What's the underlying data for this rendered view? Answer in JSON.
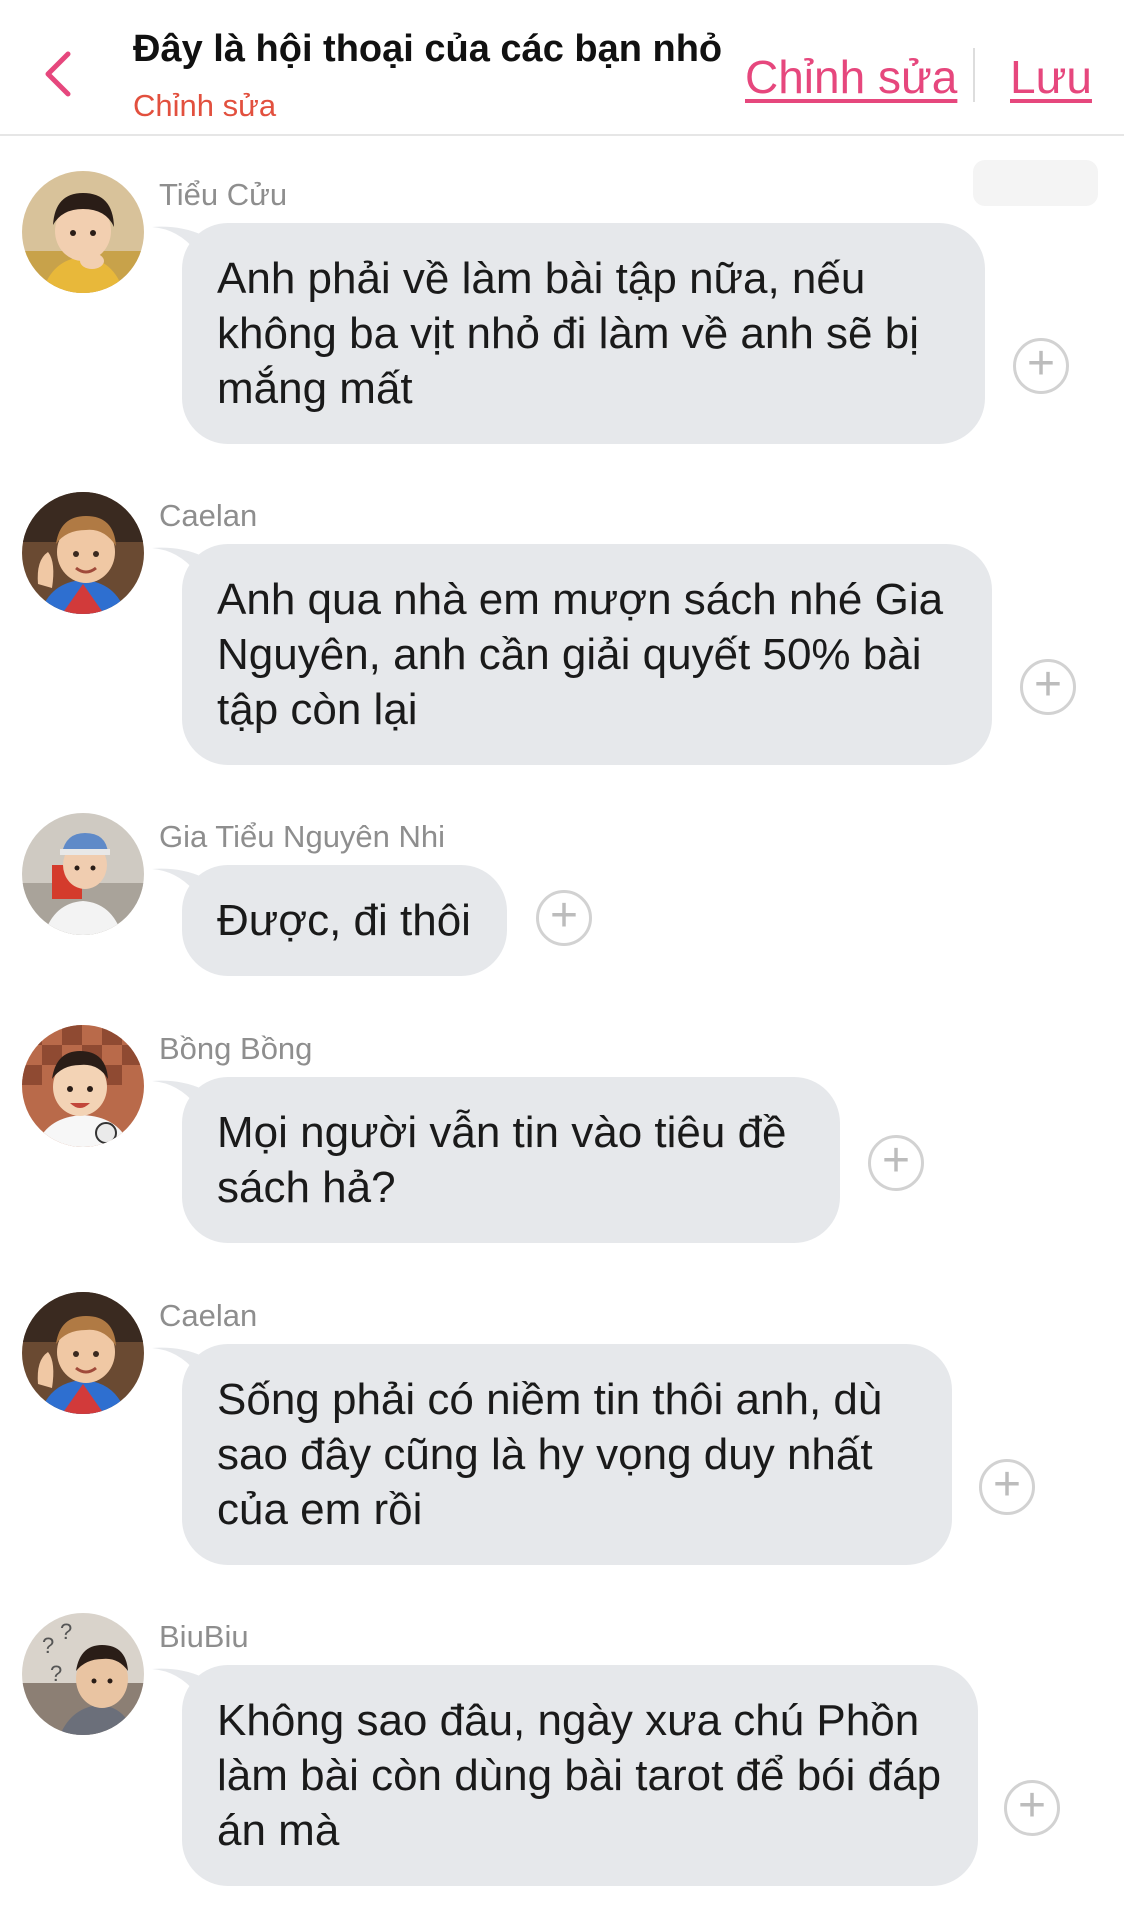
{
  "header": {
    "title": "Đây là hội thoại của các bạn nhỏ",
    "subtitle": "Chỉnh sửa",
    "edit_label": "Chỉnh sửa",
    "save_label": "Lưu",
    "accent_color": "#e6477d",
    "back_icon": "chevron-left-icon"
  },
  "messages": [
    {
      "sender": "Tiểu Cửu",
      "text": "Anh phải về làm bài tập nữa, nếu không ba vịt nhỏ đi làm về anh sẽ bị mắng mất",
      "add_icon": "plus-circle-icon"
    },
    {
      "sender": "Caelan",
      "text": "Anh qua nhà em mượn sách nhé Gia Nguyên, anh cần giải quyết 50% bài tập còn lại",
      "add_icon": "plus-circle-icon"
    },
    {
      "sender": "Gia Tiểu Nguyên Nhi",
      "text": "Được, đi thôi",
      "add_icon": "plus-circle-icon"
    },
    {
      "sender": "Bồng Bồng",
      "text": "Mọi người vẫn tin vào tiêu đề sách hả?",
      "add_icon": "plus-circle-icon"
    },
    {
      "sender": "Caelan",
      "text": "Sống phải có niềm tin thôi anh, dù sao đây cũng là hy vọng duy nhất của em rồi",
      "add_icon": "plus-circle-icon"
    },
    {
      "sender": "BiuBiu",
      "text": "Không sao đâu, ngày xưa chú Phồn làm bài còn dùng bài tarot để bói đáp án mà",
      "add_icon": "plus-circle-icon"
    }
  ]
}
